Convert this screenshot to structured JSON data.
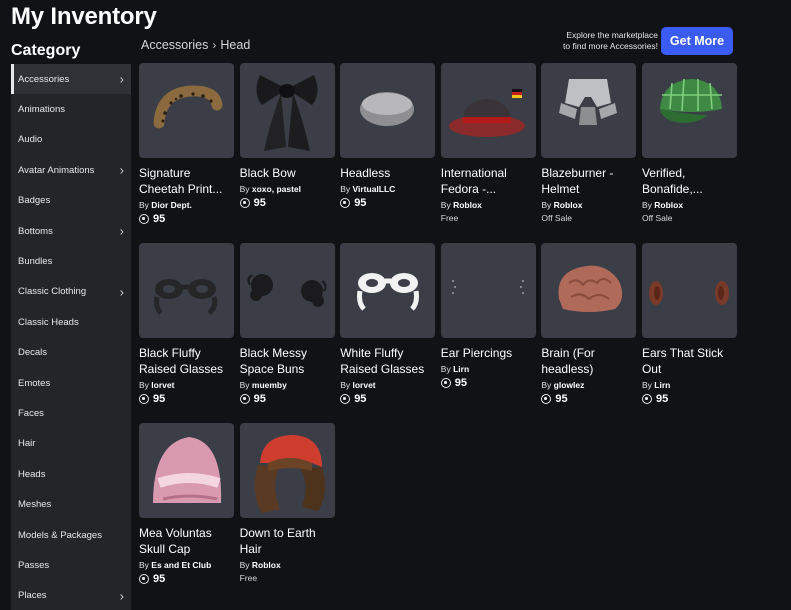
{
  "page": {
    "title": "My Inventory",
    "category_heading": "Category"
  },
  "breadcrumb": [
    "Accessories",
    "Head"
  ],
  "promo": {
    "line1": "Explore the marketplace",
    "line2": "to find more Accessories!",
    "button_label": "Get More",
    "accent": "#3b5bf5"
  },
  "sidebar": {
    "items": [
      {
        "label": "Accessories",
        "chevron": true,
        "selected": true
      },
      {
        "label": "Animations",
        "chevron": false
      },
      {
        "label": "Audio",
        "chevron": false
      },
      {
        "label": "Avatar Animations",
        "chevron": true
      },
      {
        "label": "Badges",
        "chevron": false
      },
      {
        "label": "Bottoms",
        "chevron": true
      },
      {
        "label": "Bundles",
        "chevron": false
      },
      {
        "label": "Classic Clothing",
        "chevron": true
      },
      {
        "label": "Classic Heads",
        "chevron": false
      },
      {
        "label": "Decals",
        "chevron": false
      },
      {
        "label": "Emotes",
        "chevron": false
      },
      {
        "label": "Faces",
        "chevron": false
      },
      {
        "label": "Hair",
        "chevron": false
      },
      {
        "label": "Heads",
        "chevron": false
      },
      {
        "label": "Meshes",
        "chevron": false
      },
      {
        "label": "Models & Packages",
        "chevron": false
      },
      {
        "label": "Passes",
        "chevron": false
      },
      {
        "label": "Places",
        "chevron": true
      }
    ]
  },
  "items": [
    {
      "name": "Signature Cheetah Print...",
      "by": "By",
      "creator": "Dior Dept.",
      "price": "95",
      "status": "",
      "icon": "cheetah-headband"
    },
    {
      "name": "Black Bow",
      "by": "By",
      "creator": "xoxo, pastel",
      "price": "95",
      "status": "",
      "icon": "black-bow"
    },
    {
      "name": "Headless",
      "by": "By",
      "creator": "VirtualLLC",
      "price": "95",
      "status": "",
      "icon": "headless"
    },
    {
      "name": "International Fedora -...",
      "by": "By",
      "creator": "Roblox",
      "price": "",
      "status": "Free",
      "icon": "fedora"
    },
    {
      "name": "Blazeburner - Helmet",
      "by": "By",
      "creator": "Roblox",
      "price": "",
      "status": "Off Sale",
      "icon": "helmet"
    },
    {
      "name": "Verified, Bonafide,...",
      "by": "By",
      "creator": "Roblox",
      "price": "",
      "status": "Off Sale",
      "icon": "plaid-cap"
    },
    {
      "name": "Black Fluffy Raised Glasses",
      "by": "By",
      "creator": "lorvet",
      "price": "95",
      "status": "",
      "icon": "black-glasses"
    },
    {
      "name": "Black Messy Space Buns",
      "by": "By",
      "creator": "muemby",
      "price": "95",
      "status": "",
      "icon": "space-buns"
    },
    {
      "name": "White Fluffy Raised Glasses",
      "by": "By",
      "creator": "lorvet",
      "price": "95",
      "status": "",
      "icon": "white-glasses"
    },
    {
      "name": "Ear Piercings",
      "by": "By",
      "creator": "Lirn",
      "price": "95",
      "status": "",
      "icon": "ear-piercings"
    },
    {
      "name": "Brain (For headless)",
      "by": "By",
      "creator": "glowlez",
      "price": "95",
      "status": "",
      "icon": "brain"
    },
    {
      "name": "Ears That Stick Out",
      "by": "By",
      "creator": "Lirn",
      "price": "95",
      "status": "",
      "icon": "ears"
    },
    {
      "name": "Mea Voluntas Skull Cap",
      "by": "By",
      "creator": "Es and Et Club",
      "price": "95",
      "status": "",
      "icon": "skull-cap"
    },
    {
      "name": "Down to Earth Hair",
      "by": "By",
      "creator": "Roblox",
      "price": "",
      "status": "Free",
      "icon": "hair"
    }
  ]
}
